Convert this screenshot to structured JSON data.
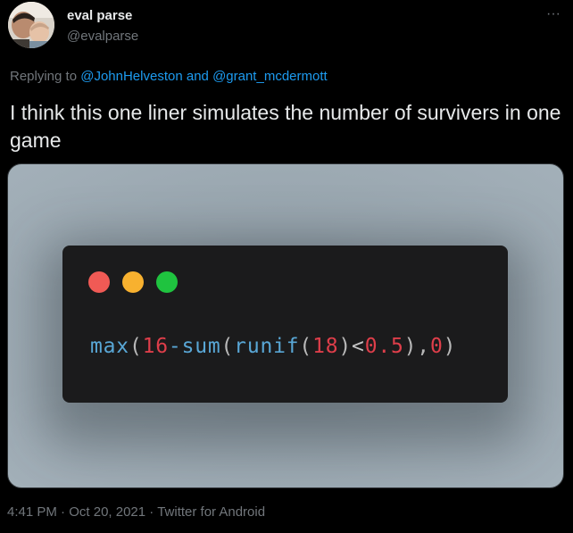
{
  "author": {
    "name": "eval parse",
    "handle": "@evalparse",
    "more_label": "···"
  },
  "reply": {
    "prefix": "Replying to",
    "mention_1": "@JohnHelveston",
    "conjunction": "and",
    "mention_2": "@grant_mcdermott"
  },
  "tweet": {
    "text": "I think this one liner simulates the number of survivers in one game"
  },
  "media": {
    "code_tokens": {
      "fn_max": "max",
      "paren_1": "(",
      "num_16": "16",
      "op_minus": "-",
      "fn_sum": "sum",
      "paren_2": "(",
      "fn_runif": "runif",
      "paren_3": "(",
      "num_18": "18",
      "paren_4": ")",
      "op_lt": "<",
      "num_05": "0.5",
      "paren_5": ")",
      "comma": ",",
      "num_0": "0",
      "paren_6": ")"
    },
    "colors": {
      "background": "#98a5ae",
      "window": "#1b1b1c",
      "dot_red": "#f05a55",
      "dot_yellow": "#f8b12f",
      "dot_green": "#1fc33f",
      "function": "#59a7d6",
      "number": "#de3e4a"
    }
  },
  "footer": {
    "time": "4:41 PM",
    "separator_1": " · ",
    "date": "Oct 20, 2021",
    "separator_2": " · ",
    "source": "Twitter for Android"
  }
}
